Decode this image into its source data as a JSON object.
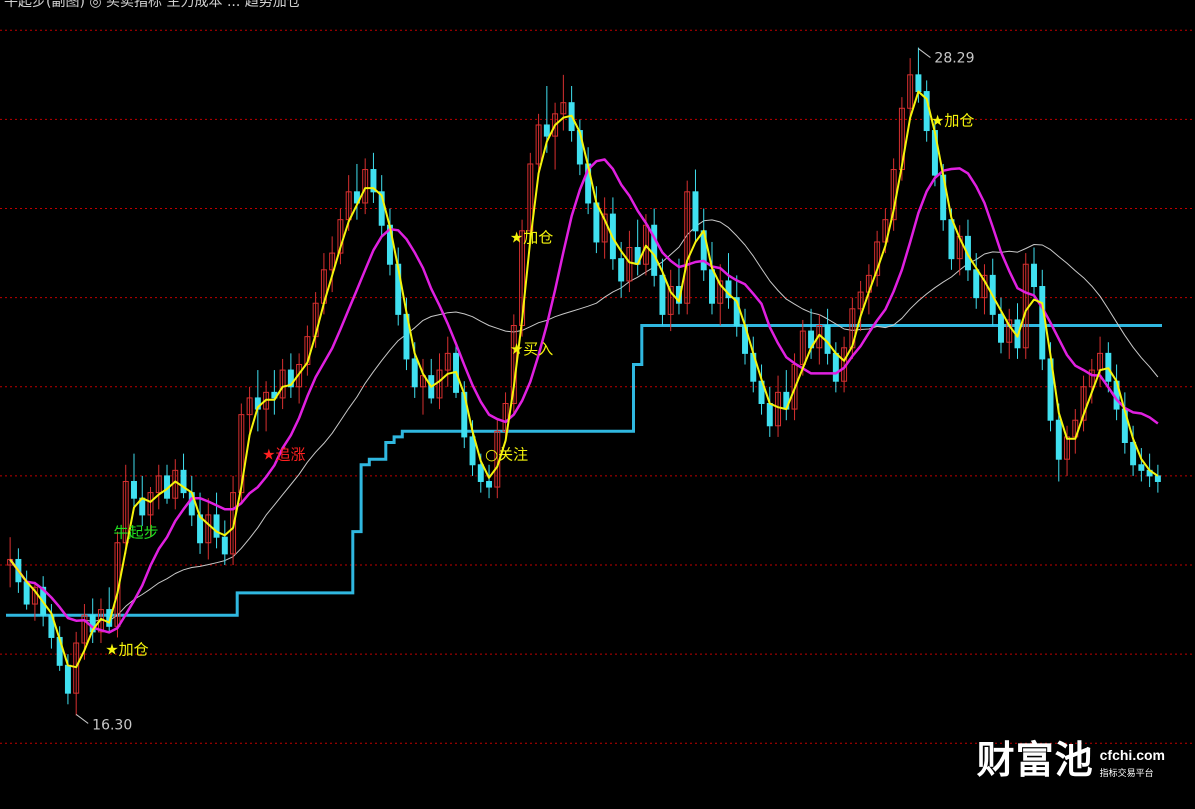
{
  "header": {
    "text": "牛起步(副图) ◎ 买卖指标 主力成本 ... 趋势加仓"
  },
  "watermark": {
    "logo": "财富池",
    "domain": "cfchi.com",
    "sub": "指标交易平台"
  },
  "colors": {
    "background": "#000000",
    "grid": "#c00000",
    "up_candle": "#d83030",
    "down_candle": "#40e0f0",
    "yellow_line": "#f4f40c",
    "magenta_line": "#e020e0",
    "white_line": "#c8c8c8",
    "cost_line": "#30b8e0",
    "signal_buy": "#f4f40c",
    "signal_alert": "#ff2020",
    "signal_start": "#20e020"
  },
  "chart_data": {
    "type": "candlestick",
    "y_range": [
      15.5,
      29.0
    ],
    "gridlines": [
      28.6,
      27.0,
      25.4,
      23.8,
      22.2,
      20.6,
      19.0,
      17.4,
      15.8
    ],
    "high_label": "28.29",
    "low_label": "16.30",
    "candles": [
      [
        19.0,
        19.5,
        18.6,
        19.1
      ],
      [
        19.1,
        19.3,
        18.5,
        18.7
      ],
      [
        18.7,
        18.9,
        18.2,
        18.3
      ],
      [
        18.3,
        18.7,
        18.0,
        18.6
      ],
      [
        18.6,
        18.8,
        17.9,
        18.1
      ],
      [
        18.1,
        18.3,
        17.5,
        17.7
      ],
      [
        17.7,
        17.9,
        17.1,
        17.2
      ],
      [
        17.2,
        17.4,
        16.5,
        16.7
      ],
      [
        16.7,
        17.8,
        16.3,
        17.6
      ],
      [
        17.6,
        18.3,
        17.3,
        18.1
      ],
      [
        18.1,
        18.4,
        17.6,
        17.8
      ],
      [
        17.8,
        18.4,
        17.6,
        18.2
      ],
      [
        18.2,
        18.6,
        17.8,
        17.9
      ],
      [
        17.9,
        19.6,
        17.7,
        19.4
      ],
      [
        19.4,
        20.8,
        19.2,
        20.5
      ],
      [
        20.5,
        21.0,
        20.0,
        20.2
      ],
      [
        20.2,
        20.6,
        19.7,
        19.9
      ],
      [
        19.9,
        20.4,
        19.5,
        20.3
      ],
      [
        20.3,
        20.8,
        20.0,
        20.6
      ],
      [
        20.6,
        20.8,
        20.1,
        20.2
      ],
      [
        20.2,
        20.9,
        20.0,
        20.7
      ],
      [
        20.7,
        21.0,
        20.2,
        20.3
      ],
      [
        20.3,
        20.6,
        19.7,
        19.9
      ],
      [
        19.9,
        20.3,
        19.2,
        19.4
      ],
      [
        19.4,
        20.2,
        19.1,
        19.9
      ],
      [
        19.9,
        20.3,
        19.3,
        19.5
      ],
      [
        19.5,
        19.8,
        19.0,
        19.2
      ],
      [
        19.2,
        20.6,
        19.0,
        20.3
      ],
      [
        20.3,
        21.9,
        20.1,
        21.7
      ],
      [
        21.7,
        22.2,
        21.3,
        22.0
      ],
      [
        22.0,
        22.5,
        21.4,
        21.8
      ],
      [
        21.8,
        22.3,
        21.4,
        22.1
      ],
      [
        22.1,
        22.5,
        21.7,
        22.0
      ],
      [
        22.0,
        22.7,
        21.8,
        22.5
      ],
      [
        22.5,
        22.8,
        22.0,
        22.2
      ],
      [
        22.2,
        22.8,
        21.9,
        22.6
      ],
      [
        22.6,
        23.3,
        22.4,
        23.1
      ],
      [
        23.1,
        23.9,
        22.9,
        23.7
      ],
      [
        23.7,
        24.6,
        23.5,
        24.3
      ],
      [
        24.3,
        24.9,
        23.9,
        24.6
      ],
      [
        24.6,
        25.4,
        24.4,
        25.2
      ],
      [
        25.2,
        26.0,
        25.0,
        25.7
      ],
      [
        25.7,
        26.2,
        25.2,
        25.5
      ],
      [
        25.5,
        26.3,
        25.3,
        26.1
      ],
      [
        26.1,
        26.4,
        25.5,
        25.7
      ],
      [
        25.7,
        26.0,
        24.9,
        25.1
      ],
      [
        25.1,
        25.4,
        24.2,
        24.4
      ],
      [
        24.4,
        24.7,
        23.3,
        23.5
      ],
      [
        23.5,
        23.8,
        22.5,
        22.7
      ],
      [
        22.7,
        23.0,
        22.0,
        22.2
      ],
      [
        22.2,
        22.7,
        21.7,
        22.4
      ],
      [
        22.4,
        22.7,
        21.9,
        22.0
      ],
      [
        22.0,
        22.8,
        21.8,
        22.5
      ],
      [
        22.5,
        23.1,
        22.2,
        22.8
      ],
      [
        22.8,
        23.0,
        22.0,
        22.1
      ],
      [
        22.1,
        22.3,
        21.1,
        21.3
      ],
      [
        21.3,
        21.6,
        20.6,
        20.8
      ],
      [
        20.8,
        21.0,
        20.3,
        20.5
      ],
      [
        20.5,
        20.8,
        20.2,
        20.4
      ],
      [
        20.4,
        21.6,
        20.2,
        21.4
      ],
      [
        21.4,
        22.1,
        21.2,
        21.9
      ],
      [
        21.9,
        23.5,
        21.7,
        23.3
      ],
      [
        23.3,
        25.2,
        23.1,
        25.0
      ],
      [
        25.0,
        26.4,
        24.8,
        26.2
      ],
      [
        26.2,
        27.1,
        26.0,
        26.9
      ],
      [
        26.9,
        27.6,
        26.4,
        26.7
      ],
      [
        26.7,
        27.3,
        26.1,
        27.1
      ],
      [
        27.1,
        27.8,
        26.8,
        27.3
      ],
      [
        27.3,
        27.6,
        26.6,
        26.8
      ],
      [
        26.8,
        27.0,
        26.0,
        26.2
      ],
      [
        26.2,
        26.5,
        25.3,
        25.5
      ],
      [
        25.5,
        25.8,
        24.6,
        24.8
      ],
      [
        24.8,
        25.6,
        24.5,
        25.3
      ],
      [
        25.3,
        25.6,
        24.3,
        24.5
      ],
      [
        24.5,
        24.8,
        23.8,
        24.1
      ],
      [
        24.1,
        25.0,
        23.9,
        24.7
      ],
      [
        24.7,
        25.2,
        24.2,
        24.4
      ],
      [
        24.4,
        25.3,
        24.2,
        25.1
      ],
      [
        25.1,
        25.4,
        24.0,
        24.2
      ],
      [
        24.2,
        24.5,
        23.3,
        23.5
      ],
      [
        23.5,
        24.3,
        23.2,
        24.0
      ],
      [
        24.0,
        24.5,
        23.5,
        23.7
      ],
      [
        23.7,
        25.9,
        23.5,
        25.7
      ],
      [
        25.7,
        26.1,
        24.8,
        25.0
      ],
      [
        25.0,
        25.4,
        24.1,
        24.3
      ],
      [
        24.3,
        24.8,
        23.5,
        23.7
      ],
      [
        23.7,
        24.4,
        23.3,
        24.1
      ],
      [
        24.1,
        24.6,
        23.6,
        23.8
      ],
      [
        23.8,
        24.2,
        23.1,
        23.3
      ],
      [
        23.3,
        23.6,
        22.6,
        22.8
      ],
      [
        22.8,
        23.1,
        22.1,
        22.3
      ],
      [
        22.3,
        22.6,
        21.7,
        21.9
      ],
      [
        21.9,
        22.2,
        21.3,
        21.5
      ],
      [
        21.5,
        22.4,
        21.3,
        22.1
      ],
      [
        22.1,
        22.5,
        21.6,
        21.8
      ],
      [
        21.8,
        22.8,
        21.6,
        22.6
      ],
      [
        22.6,
        23.4,
        22.4,
        23.2
      ],
      [
        23.2,
        23.6,
        22.7,
        22.9
      ],
      [
        22.9,
        23.5,
        22.6,
        23.3
      ],
      [
        23.3,
        23.6,
        22.6,
        22.8
      ],
      [
        22.8,
        23.0,
        22.1,
        22.3
      ],
      [
        22.3,
        23.1,
        22.1,
        22.9
      ],
      [
        22.9,
        23.8,
        22.7,
        23.6
      ],
      [
        23.6,
        24.1,
        23.2,
        23.9
      ],
      [
        23.9,
        24.4,
        23.5,
        24.2
      ],
      [
        24.2,
        25.0,
        24.0,
        24.8
      ],
      [
        24.8,
        25.4,
        24.6,
        25.2
      ],
      [
        25.2,
        26.3,
        25.0,
        26.1
      ],
      [
        26.1,
        27.4,
        25.9,
        27.2
      ],
      [
        27.2,
        28.1,
        27.0,
        27.8
      ],
      [
        27.8,
        28.29,
        27.3,
        27.5
      ],
      [
        27.5,
        27.7,
        26.6,
        26.8
      ],
      [
        26.8,
        27.0,
        25.8,
        26.0
      ],
      [
        26.0,
        26.2,
        25.0,
        25.2
      ],
      [
        25.2,
        25.4,
        24.3,
        24.5
      ],
      [
        24.5,
        25.1,
        24.2,
        24.9
      ],
      [
        24.9,
        25.2,
        24.1,
        24.3
      ],
      [
        24.3,
        24.6,
        23.6,
        23.8
      ],
      [
        23.8,
        24.4,
        23.5,
        24.2
      ],
      [
        24.2,
        24.5,
        23.3,
        23.5
      ],
      [
        23.5,
        23.8,
        22.8,
        23.0
      ],
      [
        23.0,
        23.6,
        22.7,
        23.4
      ],
      [
        23.4,
        23.7,
        22.7,
        22.9
      ],
      [
        22.9,
        24.6,
        22.7,
        24.4
      ],
      [
        24.4,
        24.7,
        23.8,
        24.0
      ],
      [
        24.0,
        24.3,
        22.5,
        22.7
      ],
      [
        22.7,
        23.0,
        21.4,
        21.6
      ],
      [
        21.6,
        21.9,
        20.5,
        20.9
      ],
      [
        20.9,
        21.5,
        20.6,
        21.3
      ],
      [
        21.3,
        21.8,
        21.0,
        21.6
      ],
      [
        21.6,
        22.4,
        21.4,
        22.2
      ],
      [
        22.2,
        22.7,
        21.9,
        22.5
      ],
      [
        22.5,
        23.1,
        22.2,
        22.8
      ],
      [
        22.8,
        23.0,
        22.1,
        22.3
      ],
      [
        22.3,
        22.6,
        21.6,
        21.8
      ],
      [
        21.8,
        22.1,
        21.0,
        21.2
      ],
      [
        21.2,
        21.5,
        20.6,
        20.8
      ],
      [
        20.8,
        21.1,
        20.5,
        20.7
      ],
      [
        20.7,
        21.0,
        20.4,
        20.6
      ],
      [
        20.6,
        20.8,
        20.3,
        20.5
      ]
    ],
    "signals": [
      {
        "label": "牛起步",
        "kind": "start",
        "index": 13,
        "price": 19.6
      },
      {
        "label": "★加仓",
        "kind": "buy",
        "index": 12,
        "price": 17.5
      },
      {
        "label": "★追涨",
        "kind": "alert",
        "index": 31,
        "price": 21.0
      },
      {
        "label": "○关注",
        "kind": "buy",
        "index": 58,
        "price": 21.0
      },
      {
        "label": "★买入",
        "kind": "buy",
        "index": 61,
        "price": 22.9
      },
      {
        "label": "★加仓",
        "kind": "buy",
        "index": 61,
        "price": 24.9
      },
      {
        "label": "★加仓",
        "kind": "buy",
        "index": 112,
        "price": 27.0
      }
    ]
  }
}
